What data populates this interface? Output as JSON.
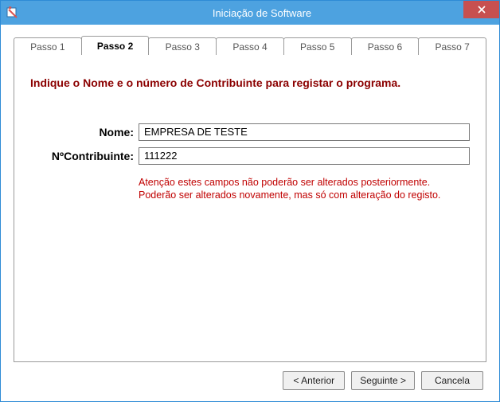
{
  "window": {
    "title": "Iniciação de Software"
  },
  "tabs": {
    "items": [
      {
        "label": "Passo 1"
      },
      {
        "label": "Passo 2"
      },
      {
        "label": "Passo 3"
      },
      {
        "label": "Passo 4"
      },
      {
        "label": "Passo 5"
      },
      {
        "label": "Passo 6"
      },
      {
        "label": "Passo 7"
      }
    ],
    "active_index": 1
  },
  "page": {
    "instructions": "Indique o Nome e o número de Contribuinte para registar o programa.",
    "fields": {
      "name_label": "Nome:",
      "name_value": "EMPRESA DE TESTE",
      "taxid_label": "NºContribuinte:",
      "taxid_value": "111222"
    },
    "warning": "Atenção estes campos não poderão ser alterados posteriormente. Poderão ser alterados novamente, mas  só com alteração do registo."
  },
  "buttons": {
    "back": "< Anterior",
    "next": "Seguinte >",
    "cancel": "Cancela"
  }
}
